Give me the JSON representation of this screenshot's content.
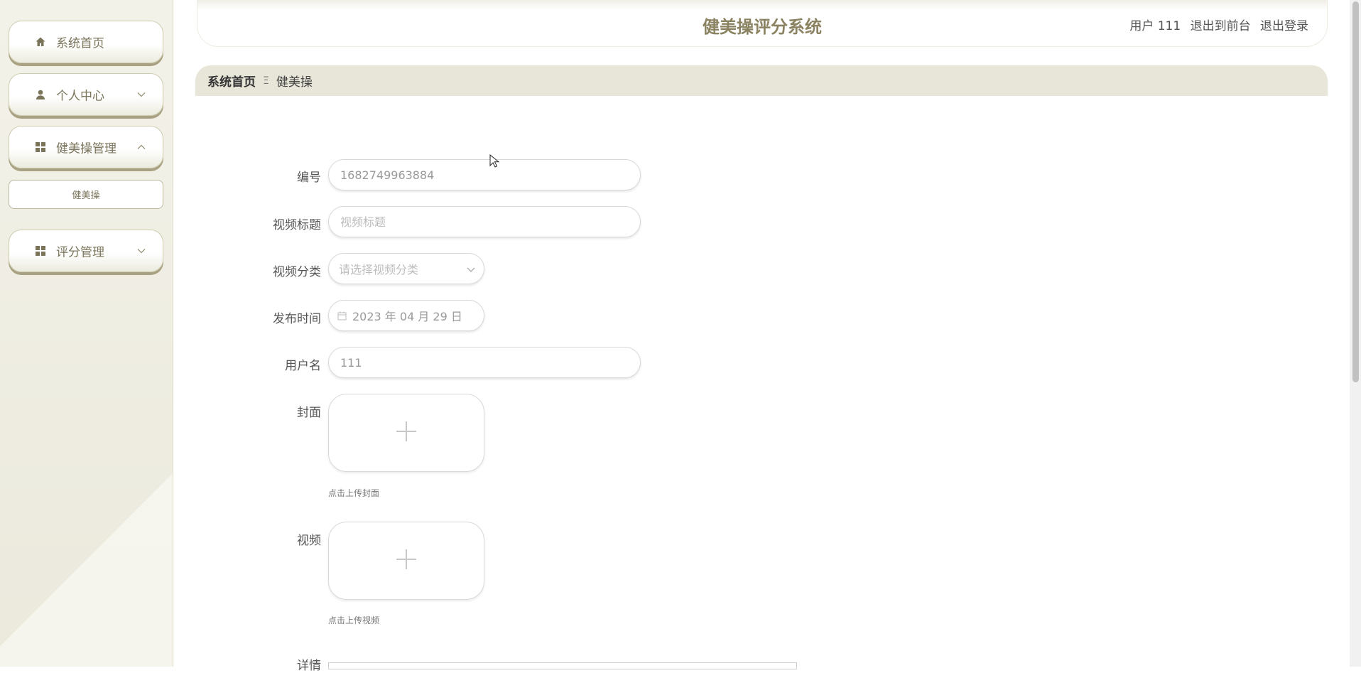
{
  "sidebar": {
    "items": [
      {
        "label": "系统首页",
        "icon": "home-icon"
      },
      {
        "label": "个人中心",
        "icon": "user-icon"
      },
      {
        "label": "健美操管理",
        "icon": "grid-icon"
      },
      {
        "label": "评分管理",
        "icon": "grid-icon"
      }
    ],
    "submenu": {
      "label": "健美操"
    }
  },
  "header": {
    "title": "健美操评分系统",
    "user_label": "用户 111",
    "to_frontend": "退出到前台",
    "logout": "退出登录"
  },
  "breadcrumb": {
    "home": "系统首页",
    "separator": "Ξ",
    "current": "健美操"
  },
  "form": {
    "number": {
      "label": "编号",
      "value": "1682749963884"
    },
    "video_title": {
      "label": "视频标题",
      "placeholder": "视频标题"
    },
    "video_category": {
      "label": "视频分类",
      "placeholder": "请选择视频分类"
    },
    "publish_time": {
      "label": "发布时间",
      "value": "2023 年 04 月 29 日"
    },
    "username": {
      "label": "用户名",
      "value": "111"
    },
    "cover": {
      "label": "封面",
      "tip": "点击上传封面"
    },
    "video": {
      "label": "视频",
      "tip": "点击上传视频"
    },
    "detail": {
      "label": "详情"
    }
  },
  "colors": {
    "accent": "#8a8260",
    "sidebar_bg": "#ebe9dc",
    "breadcrumb_bg": "#e8e6d8"
  }
}
